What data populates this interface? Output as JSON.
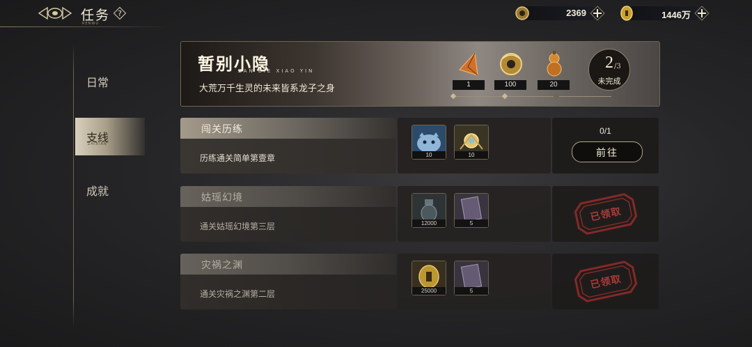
{
  "header": {
    "title": "任务",
    "subtitle": "RENWU",
    "resources": [
      {
        "name": "jade-coin",
        "value": "2369"
      },
      {
        "name": "gold-coin",
        "value": "1446万"
      }
    ]
  },
  "sidebar": {
    "tabs": [
      {
        "label": "日常",
        "sub": ""
      },
      {
        "label": "支线",
        "sub": "ZHIXIAN"
      },
      {
        "label": "成就",
        "sub": ""
      }
    ]
  },
  "banner": {
    "title": "暂别小隐",
    "pinyin": "ZAN BIE XIAO YIN",
    "description": "大荒万千生灵的未来皆系龙子之身",
    "rewards": [
      {
        "icon": "pyramid-gem-icon",
        "qty": "1"
      },
      {
        "icon": "jade-dragon-coin-icon",
        "qty": "100"
      },
      {
        "icon": "gourd-icon",
        "qty": "20"
      }
    ],
    "progress": {
      "current": "2",
      "total": "/3",
      "label": "未完成"
    }
  },
  "tasks": [
    {
      "name": "闯关历练",
      "description": "历练通关简单第壹章",
      "rewards": [
        {
          "icon": "blue-creature-icon",
          "qty": "10"
        },
        {
          "icon": "gold-orb-icon",
          "qty": "10"
        }
      ],
      "count": "0/1",
      "action": "前往",
      "status": "active"
    },
    {
      "name": "姑瑶幻境",
      "description": "通关姑瑶幻境第三层",
      "rewards": [
        {
          "icon": "potion-bottle-icon",
          "qty": "12000"
        },
        {
          "icon": "scroll-card-icon",
          "qty": "5"
        }
      ],
      "count": "",
      "action": "已领取",
      "status": "claimed"
    },
    {
      "name": "灾祸之渊",
      "description": "通关灾祸之渊第二层",
      "rewards": [
        {
          "icon": "gold-coin-icon",
          "qty": "25000"
        },
        {
          "icon": "scroll-card-icon",
          "qty": "5"
        }
      ],
      "count": "",
      "action": "已领取",
      "status": "claimed"
    }
  ],
  "colors": {
    "accent_gold": "#c9a65a",
    "stamp_red": "#b33c3a"
  }
}
